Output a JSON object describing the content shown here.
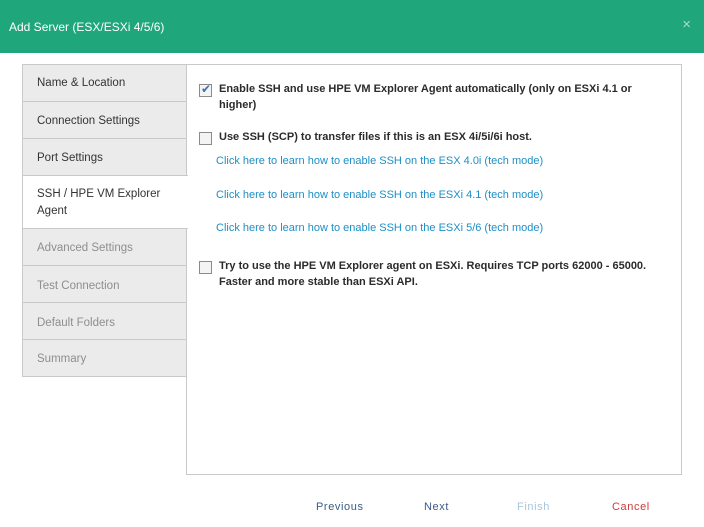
{
  "dialog": {
    "title": "Add Server (ESX/ESXi 4/5/6)",
    "close_glyph": "×"
  },
  "sidebar": {
    "items": [
      {
        "label": "Name & Location",
        "state": "enabled"
      },
      {
        "label": "Connection Settings",
        "state": "enabled"
      },
      {
        "label": "Port Settings",
        "state": "enabled"
      },
      {
        "label": "SSH / HPE VM Explorer Agent",
        "state": "active"
      },
      {
        "label": "Advanced Settings",
        "state": "disabled"
      },
      {
        "label": "Test Connection",
        "state": "disabled"
      },
      {
        "label": "Default Folders",
        "state": "disabled"
      },
      {
        "label": "Summary",
        "state": "disabled"
      }
    ]
  },
  "options": {
    "enable_ssh": {
      "checked": true,
      "label": "Enable SSH and use HPE VM Explorer Agent automatically (only on ESXi 4.1 or higher)"
    },
    "use_scp": {
      "checked": false,
      "label": "Use SSH (SCP) to transfer files if this is an ESX 4i/5i/6i host."
    },
    "links": {
      "esx40": "Click here to learn how to enable SSH on the ESX 4.0i (tech mode)",
      "esxi41": "Click here to learn how to enable SSH on the ESXi 4.1 (tech mode)",
      "esxi56": "Click here to learn how to enable SSH on the ESXi 5/6 (tech mode)"
    },
    "use_agent": {
      "checked": false,
      "label": "Try to use the HPE VM Explorer agent on ESXi. Requires TCP ports 62000 - 65000. Faster and more stable than ESXi API."
    }
  },
  "footer": {
    "previous": "Previous",
    "next": "Next",
    "finish": "Finish",
    "cancel": "Cancel"
  },
  "colors": {
    "titlebar": "#1fa67a",
    "link": "#1c8fc6",
    "cancel": "#d23a3a"
  }
}
